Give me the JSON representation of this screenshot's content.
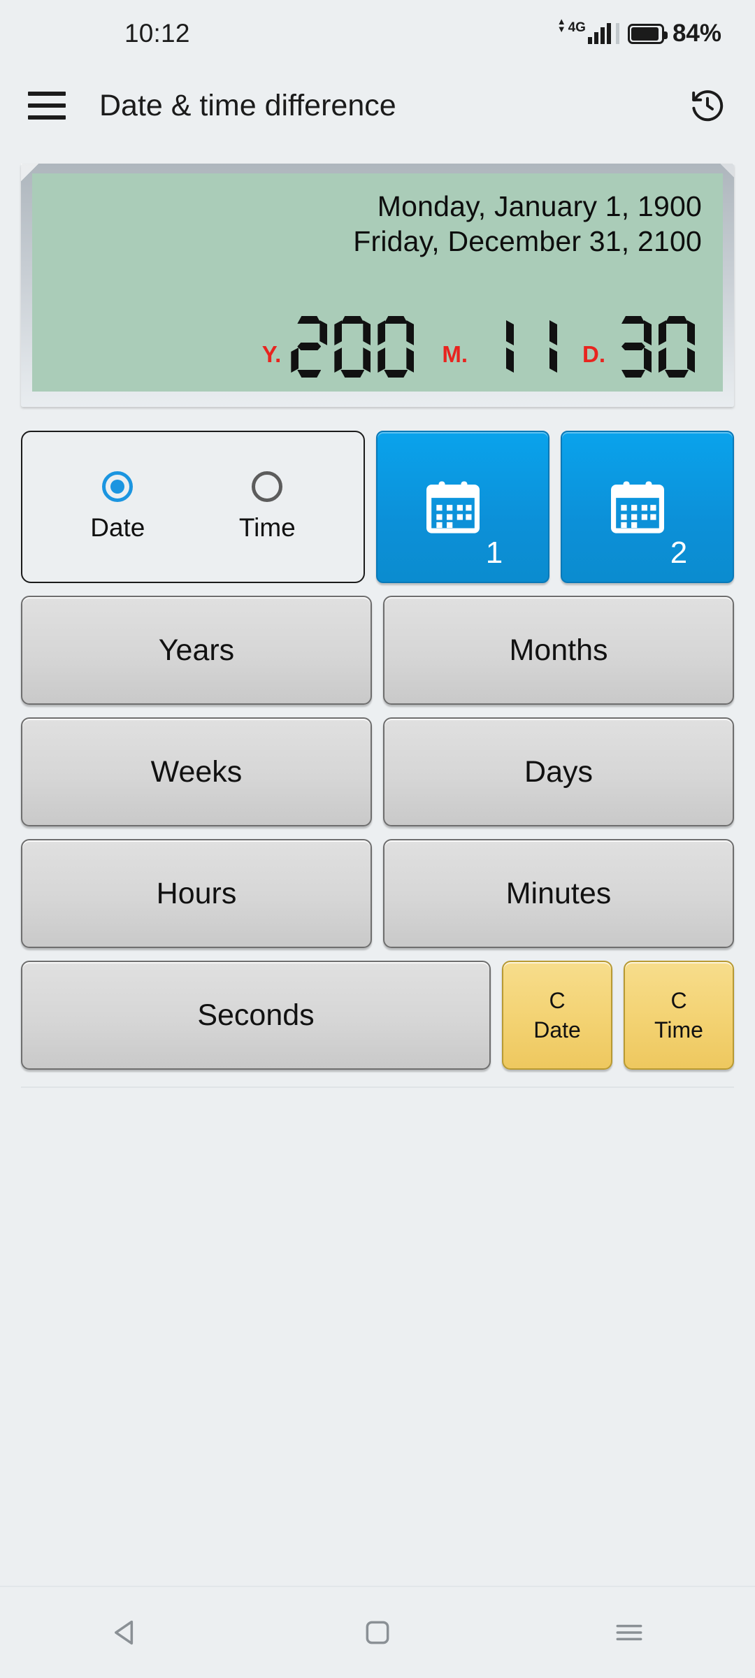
{
  "status_bar": {
    "time": "10:12",
    "network_label": "4G",
    "battery_percent": "84%",
    "battery_level": 84,
    "icons": [
      "data-arrows-icon",
      "signal-bars-icon",
      "battery-icon"
    ]
  },
  "app_bar": {
    "menu_icon": "hamburger-menu-icon",
    "title": "Date & time difference",
    "history_icon": "history-icon"
  },
  "lcd": {
    "date_from": "Monday, January 1, 1900",
    "date_to": "Friday, December 31, 2100",
    "screen_color": "#aaccb8",
    "unit_color": "#e8241f",
    "segments": [
      {
        "unit": "Y.",
        "value": "200"
      },
      {
        "unit": "M.",
        "value": "11"
      },
      {
        "unit": "D.",
        "value": "30"
      }
    ]
  },
  "mode_selector": {
    "options": [
      {
        "label": "Date",
        "selected": true
      },
      {
        "label": "Time",
        "selected": false
      }
    ],
    "accent_color": "#1b95e0"
  },
  "calendar_buttons": [
    {
      "icon": "calendar-icon",
      "number": "1",
      "color": "#0c90d8"
    },
    {
      "icon": "calendar-icon",
      "number": "2",
      "color": "#0c90d8"
    }
  ],
  "unit_buttons": [
    {
      "label": "Years"
    },
    {
      "label": "Months"
    },
    {
      "label": "Weeks"
    },
    {
      "label": "Days"
    },
    {
      "label": "Hours"
    },
    {
      "label": "Minutes"
    },
    {
      "label": "Seconds"
    }
  ],
  "clear_buttons": [
    {
      "line1": "C",
      "line2": "Date",
      "color": "#f3d272"
    },
    {
      "line1": "C",
      "line2": "Time",
      "color": "#f3d272"
    }
  ],
  "nav_bar": {
    "back_icon": "back-triangle-icon",
    "home_icon": "home-square-icon",
    "recents_icon": "recents-menu-icon"
  }
}
